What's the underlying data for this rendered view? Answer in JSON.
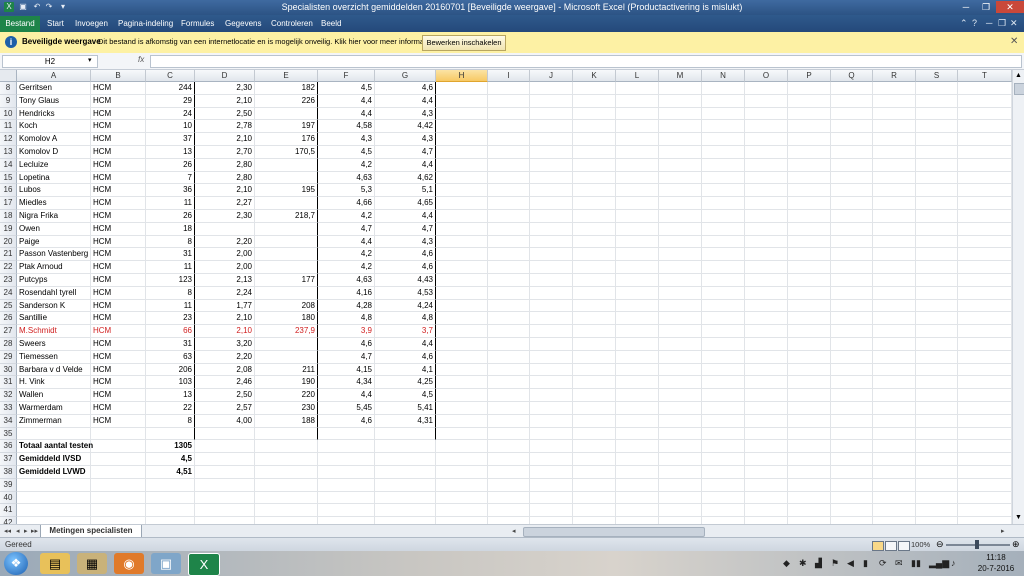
{
  "window": {
    "title": "Specialisten overzicht gemiddelden 20160701  [Beveiligde weergave] - Microsoft Excel (Productactivering is mislukt)"
  },
  "ribbon": {
    "file_tab": "Bestand",
    "tabs": [
      "Start",
      "Invoegen",
      "Pagina-indeling",
      "Formules",
      "Gegevens",
      "Controleren",
      "Beeld"
    ]
  },
  "protected_view": {
    "title": "Beveiligde weergave",
    "message": "Dit bestand is afkomstig van een internetlocatie en is mogelijk onveilig. Klik hier voor meer informatie.",
    "button": "Bewerken inschakelen"
  },
  "formula_bar": {
    "name_box": "H2",
    "fx": "fx",
    "value": ""
  },
  "grid": {
    "columns": [
      "A",
      "B",
      "C",
      "D",
      "E",
      "F",
      "G",
      "H",
      "I",
      "J",
      "K",
      "L",
      "M",
      "N",
      "O",
      "P",
      "Q",
      "R",
      "S",
      "T"
    ],
    "selected_column": "H",
    "rows": [
      {
        "n": "8",
        "a": "Gerritsen",
        "b": "HCM",
        "c": "244",
        "d": "2,30",
        "e": "182",
        "f": "4,5",
        "g": "4,6"
      },
      {
        "n": "9",
        "a": "Tony Glaus",
        "b": "HCM",
        "c": "29",
        "d": "2,10",
        "e": "226",
        "f": "4,4",
        "g": "4,4"
      },
      {
        "n": "10",
        "a": "Hendricks",
        "b": "HCM",
        "c": "24",
        "d": "2,50",
        "e": "",
        "f": "4,4",
        "g": "4,3"
      },
      {
        "n": "11",
        "a": "Koch",
        "b": "HCM",
        "c": "10",
        "d": "2,78",
        "e": "197",
        "f": "4,58",
        "g": "4,42"
      },
      {
        "n": "12",
        "a": "Komolov A",
        "b": "HCM",
        "c": "37",
        "d": "2,10",
        "e": "176",
        "f": "4,3",
        "g": "4,3"
      },
      {
        "n": "13",
        "a": "Komolov D",
        "b": "HCM",
        "c": "13",
        "d": "2,70",
        "e": "170,5",
        "f": "4,5",
        "g": "4,7"
      },
      {
        "n": "14",
        "a": "Lecluize",
        "b": "HCM",
        "c": "26",
        "d": "2,80",
        "e": "",
        "f": "4,2",
        "g": "4,4"
      },
      {
        "n": "15",
        "a": "Lopetina",
        "b": "HCM",
        "c": "7",
        "d": "2,80",
        "e": "",
        "f": "4,63",
        "g": "4,62"
      },
      {
        "n": "16",
        "a": "Lubos",
        "b": "HCM",
        "c": "36",
        "d": "2,10",
        "e": "195",
        "f": "5,3",
        "g": "5,1"
      },
      {
        "n": "17",
        "a": "Miedles",
        "b": "HCM",
        "c": "11",
        "d": "2,27",
        "e": "",
        "f": "4,66",
        "g": "4,65"
      },
      {
        "n": "18",
        "a": "Nigra Frika",
        "b": "HCM",
        "c": "26",
        "d": "2,30",
        "e": "218,7",
        "f": "4,2",
        "g": "4,4"
      },
      {
        "n": "19",
        "a": "Owen",
        "b": "HCM",
        "c": "18",
        "d": "",
        "e": "",
        "f": "4,7",
        "g": "4,7"
      },
      {
        "n": "20",
        "a": "Paige",
        "b": "HCM",
        "c": "8",
        "d": "2,20",
        "e": "",
        "f": "4,4",
        "g": "4,3"
      },
      {
        "n": "21",
        "a": "Passon Vastenberg",
        "b": "HCM",
        "c": "31",
        "d": "2,00",
        "e": "",
        "f": "4,2",
        "g": "4,6"
      },
      {
        "n": "22",
        "a": "Ptak Arnoud",
        "b": "HCM",
        "c": "11",
        "d": "2,00",
        "e": "",
        "f": "4,2",
        "g": "4,6"
      },
      {
        "n": "23",
        "a": "Putcyps",
        "b": "HCM",
        "c": "123",
        "d": "2,13",
        "e": "177",
        "f": "4,63",
        "g": "4,43"
      },
      {
        "n": "24",
        "a": "Rosendahl tyrell",
        "b": "HCM",
        "c": "8",
        "d": "2,24",
        "e": "",
        "f": "4,16",
        "g": "4,53"
      },
      {
        "n": "25",
        "a": "Sanderson K",
        "b": "HCM",
        "c": "11",
        "d": "1,77",
        "e": "208",
        "f": "4,28",
        "g": "4,24"
      },
      {
        "n": "26",
        "a": "Santillie",
        "b": "HCM",
        "c": "23",
        "d": "2,10",
        "e": "180",
        "f": "4,8",
        "g": "4,8"
      },
      {
        "n": "27",
        "a": "M.Schmidt",
        "b": "HCM",
        "c": "66",
        "d": "2,10",
        "e": "237,9",
        "f": "3,9",
        "g": "3,7",
        "red": true
      },
      {
        "n": "28",
        "a": "Sweers",
        "b": "HCM",
        "c": "31",
        "d": "3,20",
        "e": "",
        "f": "4,6",
        "g": "4,4"
      },
      {
        "n": "29",
        "a": "Tiemessen",
        "b": "HCM",
        "c": "63",
        "d": "2,20",
        "e": "",
        "f": "4,7",
        "g": "4,6"
      },
      {
        "n": "30",
        "a": "Barbara v d Velde",
        "b": "HCM",
        "c": "206",
        "d": "2,08",
        "e": "211",
        "f": "4,15",
        "g": "4,1"
      },
      {
        "n": "31",
        "a": "H. Vink",
        "b": "HCM",
        "c": "103",
        "d": "2,46",
        "e": "190",
        "f": "4,34",
        "g": "4,25"
      },
      {
        "n": "32",
        "a": "Wallen",
        "b": "HCM",
        "c": "13",
        "d": "2,50",
        "e": "220",
        "f": "4,4",
        "g": "4,5"
      },
      {
        "n": "33",
        "a": "Warmerdam",
        "b": "HCM",
        "c": "22",
        "d": "2,57",
        "e": "230",
        "f": "5,45",
        "g": "5,41"
      },
      {
        "n": "34",
        "a": "Zimmerman",
        "b": "HCM",
        "c": "8",
        "d": "4,00",
        "e": "188",
        "f": "4,6",
        "g": "4,31"
      },
      {
        "n": "35",
        "a": "",
        "b": "",
        "c": "",
        "d": "",
        "e": "",
        "f": "",
        "g": ""
      },
      {
        "n": "36",
        "a": "Totaal aantal testen",
        "b": "",
        "c": "1305",
        "d": "",
        "e": "",
        "f": "",
        "g": "",
        "bold": true
      },
      {
        "n": "37",
        "a": "Gemiddeld IVSD",
        "b": "",
        "c": "4,5",
        "d": "",
        "e": "",
        "f": "",
        "g": "",
        "bold": true
      },
      {
        "n": "38",
        "a": "Gemiddeld LVWD",
        "b": "",
        "c": "4,51",
        "d": "",
        "e": "",
        "f": "",
        "g": "",
        "bold": true
      },
      {
        "n": "39",
        "a": "",
        "b": "",
        "c": "",
        "d": "",
        "e": "",
        "f": "",
        "g": ""
      },
      {
        "n": "40",
        "a": "",
        "b": "",
        "c": "",
        "d": "",
        "e": "",
        "f": "",
        "g": ""
      },
      {
        "n": "41",
        "a": "",
        "b": "",
        "c": "",
        "d": "",
        "e": "",
        "f": "",
        "g": ""
      },
      {
        "n": "42",
        "a": "",
        "b": "",
        "c": "",
        "d": "",
        "e": "",
        "f": "",
        "g": ""
      }
    ]
  },
  "sheet_tabs": {
    "active": "Metingen specialisten"
  },
  "status_bar": {
    "status": "Gereed",
    "zoom": "100%"
  },
  "taskbar": {
    "time": "11:18",
    "date": "20-7-2016",
    "apps": [
      "explorer-icon",
      "file-manager-icon",
      "firefox-icon",
      "image-viewer-icon",
      "excel-icon"
    ]
  },
  "colors": {
    "accent_green": "#1e8449",
    "title_blue": "#2c5384",
    "warning_yellow": "#fdf1a4",
    "highlight_red": "#d02020"
  }
}
